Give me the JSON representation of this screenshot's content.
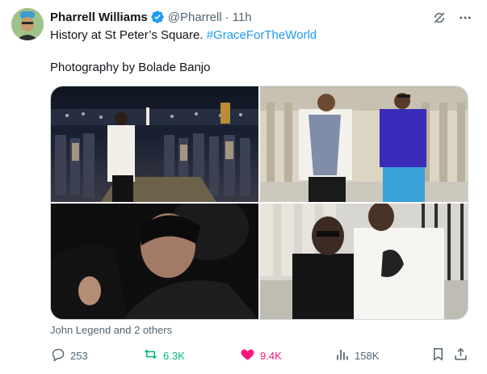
{
  "author": {
    "name": "Pharrell Williams",
    "handle": "@Pharrell",
    "separator": "·",
    "time": "11h"
  },
  "tweet": {
    "text": "History at St Peter’s Square.",
    "hashtag": "#GraceForTheWorld",
    "credit": "Photography by Bolade Banjo"
  },
  "media": {
    "tagged": "John Legend and 2 others"
  },
  "actions": {
    "replies": "253",
    "reposts": "6.3K",
    "likes": "9.4K",
    "views": "158K"
  },
  "colors": {
    "link": "#1d9bf0",
    "repost_active": "#00ba7c",
    "like_active": "#f91880",
    "verified": "#1d9bf0",
    "muted": "#536471"
  },
  "icons": [
    "verified-badge-icon",
    "grok-icon",
    "more-icon",
    "reply-icon",
    "repost-icon",
    "like-icon",
    "views-icon",
    "bookmark-icon",
    "share-icon"
  ]
}
